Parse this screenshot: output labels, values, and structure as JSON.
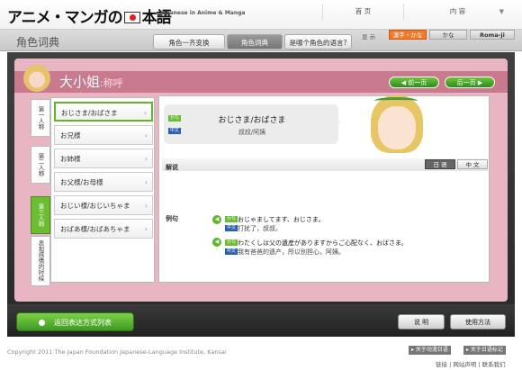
{
  "header": {
    "logo_text": "アニメ・マンガの日本語",
    "logo_part1": "アニメ・マンガの",
    "logo_part2": "本語",
    "tagline": "Japanese in Anime & Manga",
    "nav": [
      {
        "label": "首 页"
      },
      {
        "label": "内 容"
      }
    ]
  },
  "display": {
    "label": "显 示",
    "options": [
      "漢字・かな",
      "かな",
      "Roma-ji"
    ],
    "selected": "漢字・かな",
    "accent": "#f07a2a"
  },
  "page": {
    "title": "角色词典",
    "subtabs": [
      "角色一齐变换",
      "角色词典",
      "是哪个角色的语言?"
    ],
    "active_subtab": "角色词典"
  },
  "character": {
    "name": "大小姐",
    "name_sub": ":称呼",
    "prev": "前一页",
    "next": "后一页"
  },
  "vertical_tabs": [
    "第一人称",
    "第二人称",
    "第三人称",
    "表现感情的时候"
  ],
  "active_vertical_tab": "第三人称",
  "list": [
    "おじさま/おばさま",
    "お兄様",
    "お姉様",
    "お父様/お母様",
    "おじい様/おじいちゃま",
    "おばあ様/おばあちゃま"
  ],
  "selected_item": "おじさま/おばさま",
  "bubble": {
    "tag_kana": "かな",
    "tag_zh": "中文",
    "main": "おじさま/おばさま",
    "trans": "叔叔/阿姨"
  },
  "explain": {
    "label": "解说",
    "lang_ja": "日 语",
    "lang_zh": "中 文"
  },
  "examples": {
    "label": "例句",
    "items": [
      {
        "ja": "おじゃましてます、おじさま。",
        "zh": "打扰了，叔叔。"
      },
      {
        "ja": "わたくしは父の遺産がありますからご心配なく、おばさま。",
        "zh": "我有爸爸的遗产，所以别担心，阿姨。"
      }
    ]
  },
  "bottom": {
    "back": "返回表达方式列表",
    "explain_btn": "说 明",
    "usage_btn": "使用方法"
  },
  "footer": {
    "copyright": "Copyright 2011 The Japan Foundation Japanese-Language Institute, Kansai",
    "btn1": "关于动漫日语",
    "btn2": "关于日语标记",
    "links": "链接 | 网站声明 | 联系我们"
  }
}
